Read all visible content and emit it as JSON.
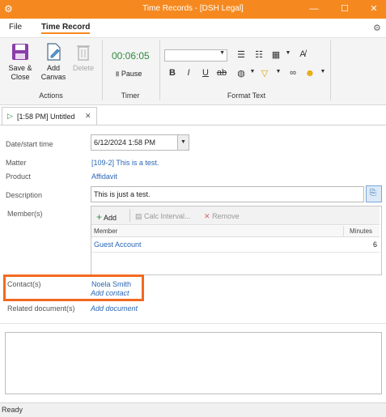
{
  "window": {
    "title": "Time Records - [DSH Legal]"
  },
  "menu": {
    "tabs": [
      "File",
      "Time Record"
    ],
    "active": "Time Record"
  },
  "ribbon": {
    "actions": {
      "save_close": [
        "Save &",
        "Close"
      ],
      "add_canvas": [
        "Add",
        "Canvas"
      ],
      "delete": "Delete",
      "group_label": "Actions"
    },
    "timer": {
      "elapsed": "00:06:05",
      "pause": "Pause",
      "group_label": "Timer"
    },
    "format_text": {
      "group_label": "Format Text"
    }
  },
  "doc_tab": {
    "label": "[1:58 PM] Untitled"
  },
  "form": {
    "date_label": "Date/start time",
    "date_value": "6/12/2024 1:58 PM",
    "matter_label": "Matter",
    "matter_value": "[109-2] This is a test.",
    "product_label": "Product",
    "product_value": "Affidavit",
    "description_label": "Description",
    "description_value": "This is just a test.",
    "members_label": "Member(s)",
    "members_toolbar": {
      "add": "Add",
      "calc": "Calc Interval...",
      "remove": "Remove"
    },
    "members_columns": [
      "Member",
      "Minutes"
    ],
    "members_rows": [
      {
        "member": "Guest Account",
        "minutes": "6"
      }
    ],
    "contacts_label": "Contact(s)",
    "contact_name": "Noela Smith",
    "add_contact": "Add contact",
    "related_label": "Related document(s)",
    "add_document": "Add document"
  },
  "status": {
    "text": "Ready"
  },
  "colors": {
    "titlebar": "#f5891f",
    "timer": "#2e8b3e",
    "link": "#2a66b5",
    "highlight": "#f26a21"
  }
}
